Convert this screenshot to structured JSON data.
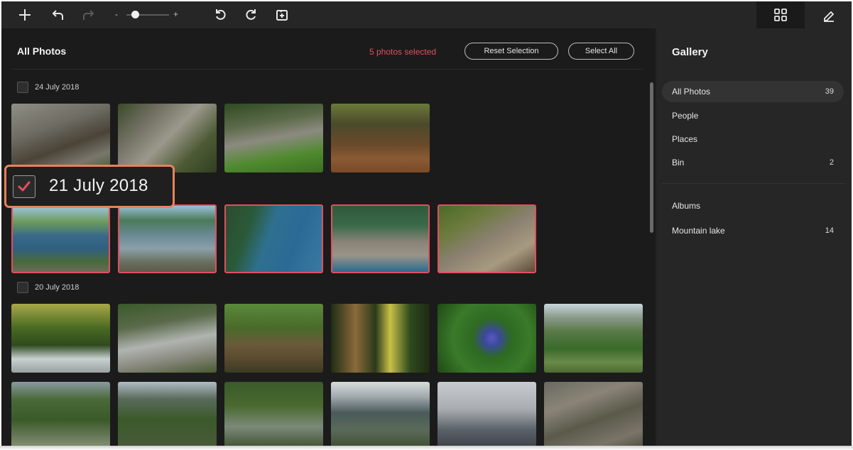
{
  "toolbar": {
    "icons": [
      "add-icon",
      "undo-icon",
      "redo-icon",
      "rotate-left-icon",
      "rotate-right-icon",
      "import-icon"
    ],
    "zoom": {
      "minus": "-",
      "plus": "+",
      "level": 0.2
    },
    "views": [
      "grid-view-icon",
      "edit-icon"
    ]
  },
  "main": {
    "title": "All Photos",
    "selected_text": "5 photos selected",
    "reset_label": "Reset Selection",
    "select_all_label": "Select All",
    "groups": [
      {
        "date": "24 July 2018",
        "checked": false,
        "photos": 4
      },
      {
        "date": "21 July 2018",
        "checked": true,
        "photos": 5
      },
      {
        "date": "20 July 2018",
        "checked": false,
        "photos": 12
      }
    ],
    "callout_label": "21 July 2018"
  },
  "sidebar": {
    "title": "Gallery",
    "items": [
      {
        "label": "All Photos",
        "count": "39"
      },
      {
        "label": "People",
        "count": ""
      },
      {
        "label": "Places",
        "count": ""
      },
      {
        "label": "Bin",
        "count": "2"
      }
    ],
    "albums": [
      {
        "label": "Albums",
        "count": ""
      },
      {
        "label": "Mountain lake",
        "count": "14"
      }
    ]
  },
  "colors": {
    "accent": "#e0505f",
    "callout_border": "#e8825b",
    "background": "#1b1b1b",
    "sidebar": "#262626"
  }
}
